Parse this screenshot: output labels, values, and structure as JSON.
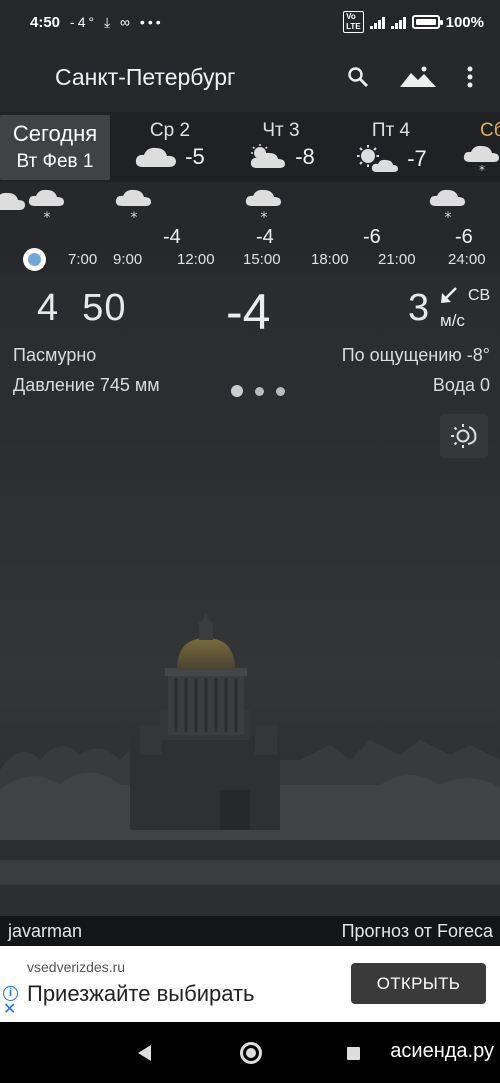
{
  "status_bar": {
    "time": "4:50",
    "notif_icons": "-4° ⤓ ∞ •••",
    "volte": "Vo LTE",
    "network": "4G",
    "battery": "100%",
    "battery_level": 1.0
  },
  "app_bar": {
    "city": "Санкт-Петербург",
    "icons": [
      "search-icon",
      "landscape-icon",
      "more-vert-icon"
    ]
  },
  "days": [
    {
      "name": "Сегодня",
      "date": "Вт Фев 1",
      "selected": true
    },
    {
      "name": "Ср 2",
      "temp": "-5",
      "icon": "cloud-icon"
    },
    {
      "name": "Чт 3",
      "temp": "-8",
      "icon": "partly-cloudy-icon"
    },
    {
      "name": "Пт 4",
      "temp": "-7",
      "icon": "sun-cloud-icon"
    },
    {
      "name": "Сб",
      "icon": "snow-cloud-icon"
    }
  ],
  "hourly": {
    "times": [
      "7:00",
      "9:00",
      "12:00",
      "15:00",
      "18:00",
      "21:00",
      "24:00"
    ],
    "temps": [
      "-4",
      "-4",
      "-6",
      "-6"
    ],
    "icons": [
      "cloud-icon",
      "snow-cloud-icon",
      "snow-cloud-icon",
      "snow-cloud-icon",
      "snow-cloud-icon"
    ]
  },
  "current": {
    "time_hour": "4",
    "time_min": "50",
    "temp": "-4",
    "wind_speed": "3",
    "wind_dir": "СВ",
    "wind_unit": "м/с",
    "condition": "Пасмурно",
    "feels_like": "По ощущению -8°",
    "pressure": "Давление 745 мм",
    "water": "Вода 0"
  },
  "credits": {
    "author": "javarman",
    "provider": "Прогноз от Foreca"
  },
  "ad": {
    "domain": "vsedverizdes.ru",
    "headline": "Приезжайте выбирать",
    "button": "ОТКРЫТЬ"
  },
  "watermark": "асиенда.ру"
}
